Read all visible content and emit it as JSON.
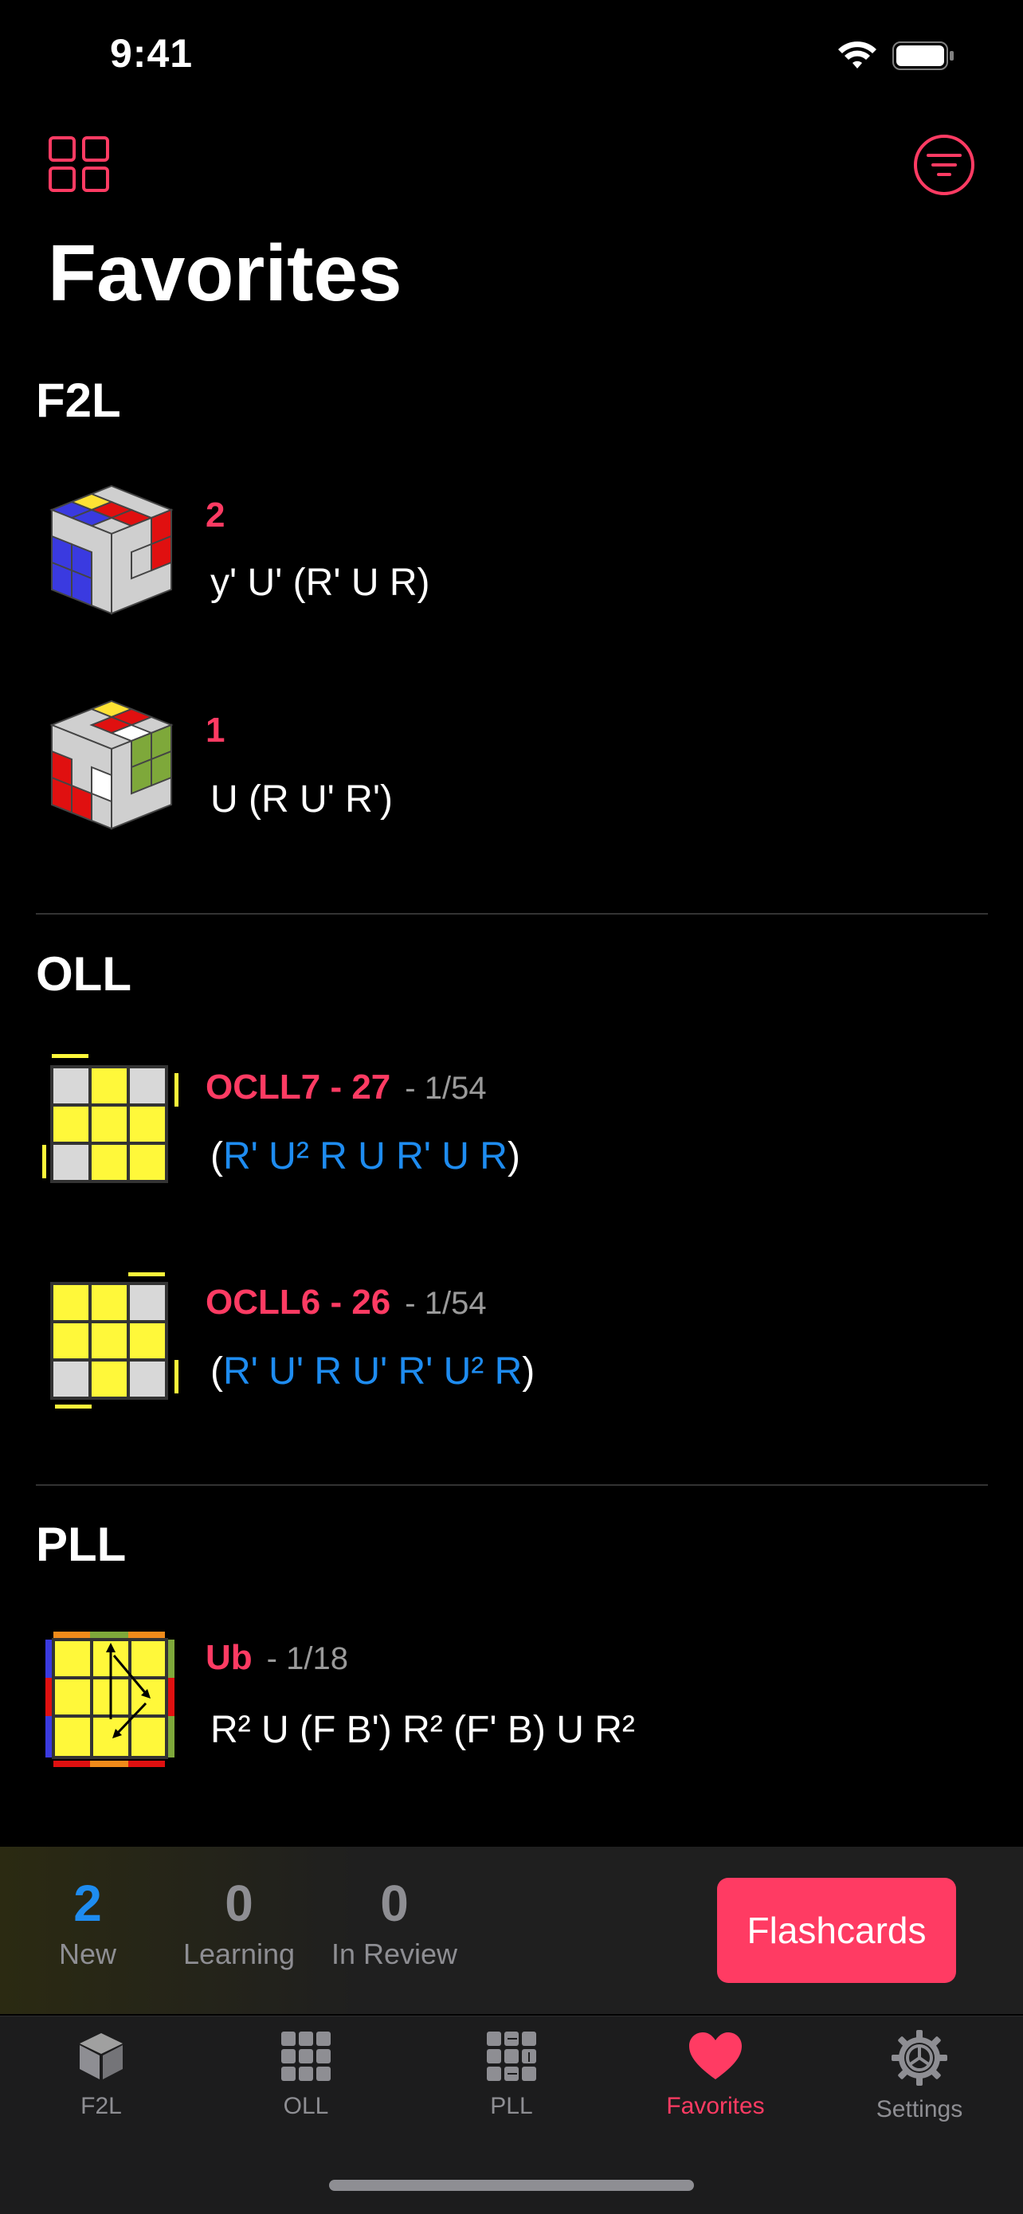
{
  "status_bar": {
    "time": "9:41"
  },
  "header": {
    "title": "Favorites"
  },
  "sections": [
    {
      "title": "F2L",
      "items": [
        {
          "name": "2",
          "alg": "y' U' (R' U R)"
        },
        {
          "name": "1",
          "alg": "U (R U' R')"
        }
      ]
    },
    {
      "title": "OLL",
      "items": [
        {
          "name": "OCLL7 - 27",
          "count": "-  1/54",
          "alg_open": "(",
          "alg_inner": "R' U² R U R' U R",
          "alg_close": ")"
        },
        {
          "name": "OCLL6 - 26",
          "count": "-  1/54",
          "alg_open": "(",
          "alg_inner": "R' U' R U' R' U² R",
          "alg_close": ")"
        }
      ]
    },
    {
      "title": "PLL",
      "items": [
        {
          "name": "Ub",
          "count": "-  1/18",
          "alg": "R² U (F B') R² (F' B) U R²"
        }
      ]
    }
  ],
  "flashcards": {
    "new": {
      "count": "2",
      "label": "New"
    },
    "learning": {
      "count": "0",
      "label": "Learning"
    },
    "review": {
      "count": "0",
      "label": "In Review"
    },
    "button_label": "Flashcards"
  },
  "tabs": [
    {
      "label": "F2L",
      "icon": "cube-icon"
    },
    {
      "label": "OLL",
      "icon": "grid-icon"
    },
    {
      "label": "PLL",
      "icon": "pll-grid-icon"
    },
    {
      "label": "Favorites",
      "icon": "heart-icon",
      "active": true
    },
    {
      "label": "Settings",
      "icon": "gear-icon"
    }
  ],
  "colors": {
    "accent": "#ff3b63",
    "blue": "#1e8cf0",
    "yellow": "#fff83a",
    "sticker_gray": "#d8d8d8"
  }
}
